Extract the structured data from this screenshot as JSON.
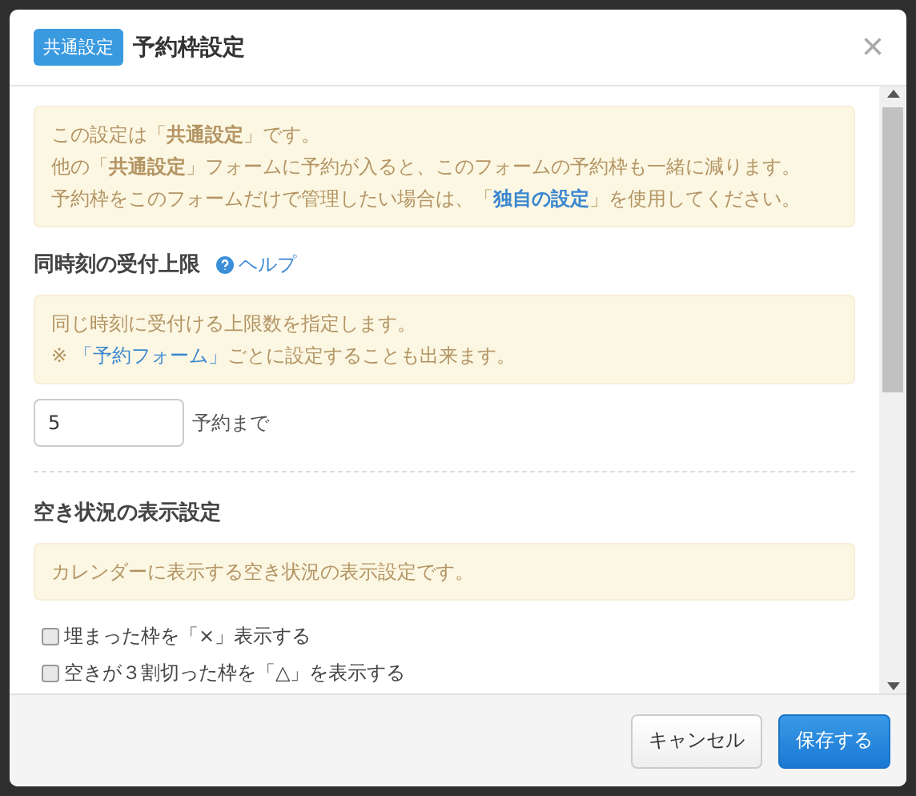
{
  "dialog": {
    "badge": "共通設定",
    "title": "予約枠設定",
    "close": "×"
  },
  "notice": [
    [
      {
        "kind": "plain",
        "text": "この設定は「"
      },
      {
        "kind": "bold",
        "text": "共通設定"
      },
      {
        "kind": "plain",
        "text": "」です。"
      }
    ],
    [
      {
        "kind": "plain",
        "text": "他の「"
      },
      {
        "kind": "bold",
        "text": "共通設定"
      },
      {
        "kind": "plain",
        "text": "」フォームに予約が入ると、このフォームの予約枠も一緒に減ります。"
      }
    ],
    [
      {
        "kind": "plain",
        "text": "予約枠をこのフォームだけで管理したい場合は、「"
      },
      {
        "kind": "link_bold",
        "text": "独自の設定"
      },
      {
        "kind": "plain",
        "text": "」を使用してください。"
      }
    ]
  ],
  "limit_section": {
    "heading": "同時刻の受付上限",
    "help": "ヘルプ",
    "notice": [
      [
        {
          "kind": "plain",
          "text": "同じ時刻に受付ける上限数を指定します。"
        }
      ],
      [
        {
          "kind": "plain",
          "text": "※ "
        },
        {
          "kind": "link",
          "text": "「予約フォーム」"
        },
        {
          "kind": "plain",
          "text": "ごとに設定することも出来ます。"
        }
      ]
    ],
    "value": "5",
    "unit": "予約まで"
  },
  "display_section": {
    "heading": "空き状況の表示設定",
    "notice": [
      [
        {
          "kind": "plain",
          "text": "カレンダーに表示する空き状況の表示設定です。"
        }
      ]
    ],
    "options": [
      {
        "label": "埋まった枠を「×」表示する",
        "checked": false
      },
      {
        "label": "空きが３割切った枠を「△」を表示する",
        "checked": false
      }
    ]
  },
  "buttons": [
    {
      "label": "キャンセル",
      "kind": "default"
    },
    {
      "label": "保存する",
      "kind": "primary"
    }
  ]
}
